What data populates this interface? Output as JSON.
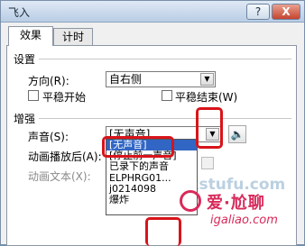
{
  "window": {
    "title": "飞入",
    "help_label": "?",
    "close_label": "X"
  },
  "tabs": [
    {
      "label": "效果",
      "active": true
    },
    {
      "label": "计时",
      "active": false
    }
  ],
  "settings": {
    "group_label": "设置",
    "direction": {
      "label": "方向(R):",
      "value": "自右侧"
    },
    "smooth_start": {
      "label": "平稳开始",
      "checked": false
    },
    "smooth_end": {
      "label": "平稳结束(W)",
      "checked": false
    }
  },
  "enhance": {
    "group_label": "增强",
    "sound": {
      "label": "声音(S):",
      "value": "[无声音]",
      "speaker_icon": "speaker-icon"
    },
    "after_anim": {
      "label": "动画播放后(A):"
    },
    "anim_text": {
      "label": "动画文本(X):"
    },
    "sound_options": [
      {
        "label": "[无声音]",
        "selected": true
      },
      {
        "label": "[停止前一声音]",
        "selected": false
      },
      {
        "label": "已录下的声音",
        "selected": false
      },
      {
        "label": "ELPHRG01...",
        "selected": false
      },
      {
        "label": "j0214098",
        "selected": false
      },
      {
        "label": "爆炸",
        "selected": false
      }
    ]
  },
  "watermark": {
    "big": "爱·尬聊",
    "small": "igaliao.com",
    "ghost": "qkstufu.com"
  },
  "colors": {
    "highlight": "#d8141b",
    "selection": "#3166c5",
    "watermark": "#d82a5a"
  }
}
